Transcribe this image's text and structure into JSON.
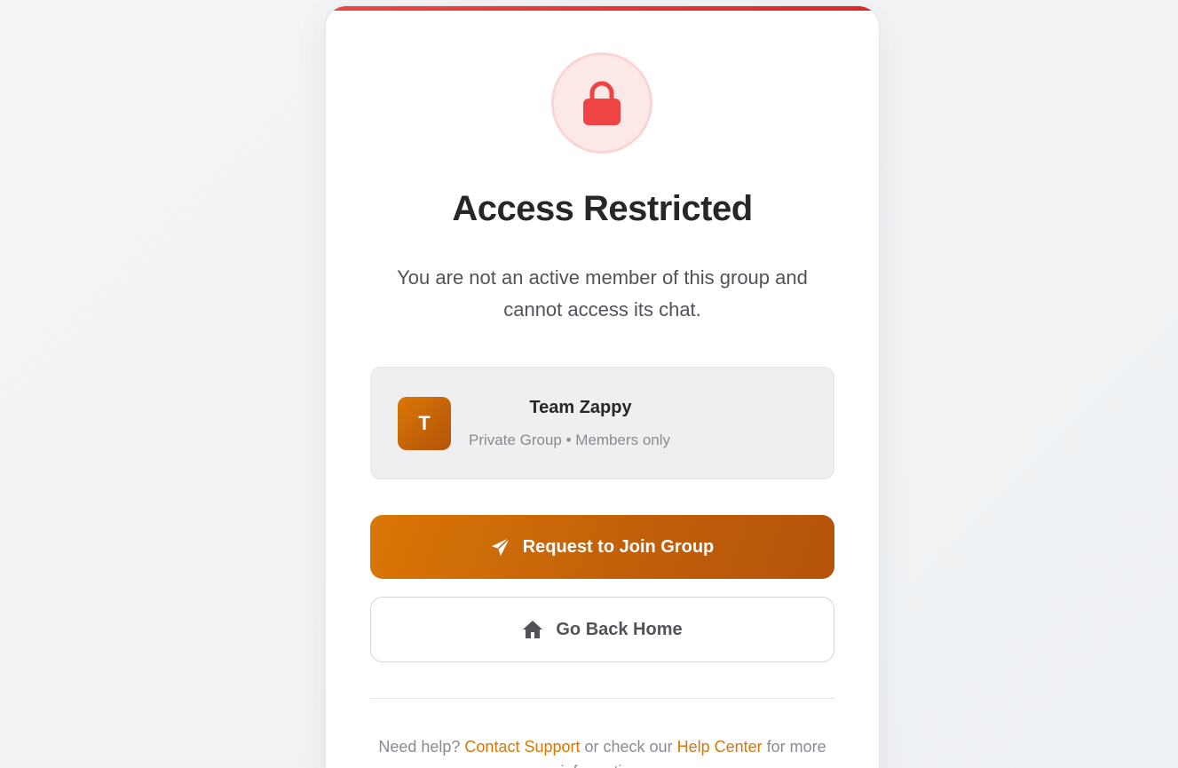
{
  "colors": {
    "accent": "#d97706",
    "accent_dark": "#b45309",
    "danger": "#ef4444",
    "danger_bg": "#fde8e8"
  },
  "header": {
    "icon": "lock-icon",
    "title": "Access Restricted",
    "message": "You are not an active member of this group and cannot access its chat."
  },
  "group": {
    "avatar_letter": "T",
    "name": "Team Zappy",
    "meta": "Private Group • Members only"
  },
  "actions": {
    "request_label": "Request to Join Group",
    "request_icon": "paper-plane-icon",
    "home_label": "Go Back Home",
    "home_icon": "home-icon"
  },
  "help": {
    "prefix": "Need help?",
    "support_link": "Contact Support",
    "middle": "or check our",
    "help_center_link": "Help Center",
    "suffix": "for more information."
  }
}
